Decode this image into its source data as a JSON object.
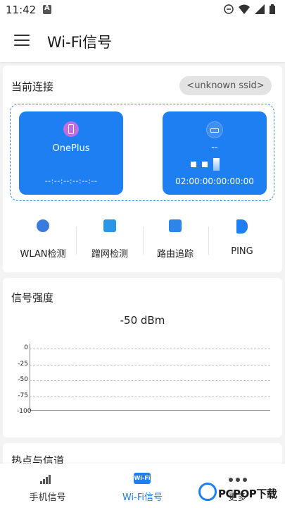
{
  "status_bar": {
    "time": "11:42",
    "icons": [
      "notification-a-icon",
      "do-not-disturb-icon",
      "wifi-icon",
      "signal-icon",
      "battery-icon"
    ]
  },
  "app_bar": {
    "title": "Wi-Fi信号",
    "menu_icon": "hamburger-menu-icon"
  },
  "connection": {
    "title": "当前连接",
    "ssid": "<unknown ssid>",
    "phone": {
      "name": "OnePlus",
      "mac": "--:--:--:--:--:--",
      "icon": "phone-icon"
    },
    "router": {
      "name": "--",
      "mac": "02:00:00:00:00:00",
      "icon": "router-icon"
    }
  },
  "tools": [
    {
      "label": "WLAN检测",
      "icon": "wlan-check-icon"
    },
    {
      "label": "蹭网检测",
      "icon": "freeloader-check-icon"
    },
    {
      "label": "路由追踪",
      "icon": "route-trace-icon"
    },
    {
      "label": "PING",
      "icon": "ping-icon"
    }
  ],
  "signal": {
    "title": "信号强度",
    "value": "-50  dBm",
    "ticks": [
      "0",
      "-25",
      "-50",
      "-75",
      "-100"
    ]
  },
  "chart_data": {
    "type": "line",
    "title": "",
    "yticks": [
      0,
      -25,
      -50,
      -75,
      -100
    ],
    "ylim": [
      -100,
      0
    ],
    "grid": true,
    "series": []
  },
  "hotspot": {
    "title": "热点与信道"
  },
  "bottom_nav": [
    {
      "label": "手机信号",
      "icon": "cell-signal-icon",
      "active": false
    },
    {
      "label": "Wi-Fi信号",
      "icon": "wifi-badge-icon",
      "badge": "Wi-Fi",
      "active": true
    },
    {
      "label": "更多",
      "icon": "more-dots-icon",
      "active": false
    }
  ],
  "watermark": {
    "text": "PCPOP下载"
  },
  "colors": {
    "accent": "#1e7ff3",
    "phone_icon": "#c36de0",
    "background": "#f3f3f3"
  }
}
